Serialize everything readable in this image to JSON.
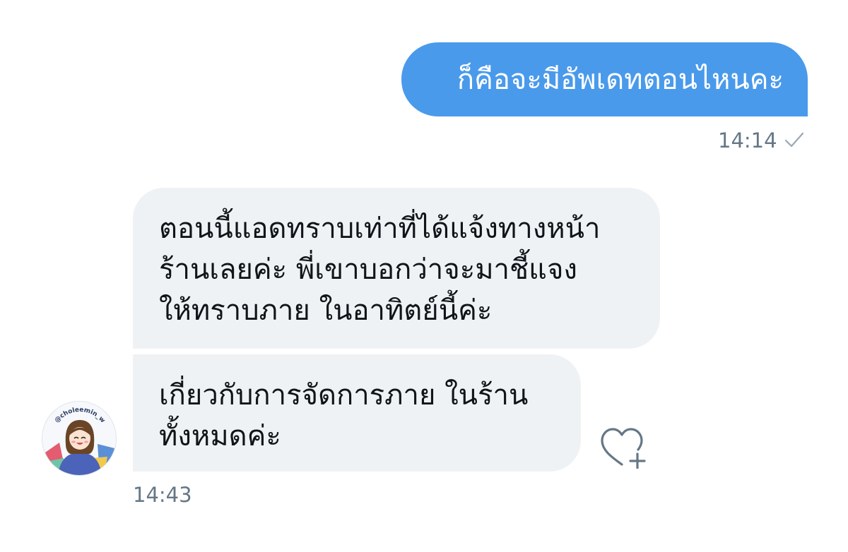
{
  "messages": {
    "outgoing": {
      "text": "ก็คือจะมีอัพเดทตอนไหนคะ",
      "time": "14:14",
      "status_icon": "checkmark-icon"
    },
    "incoming": {
      "bubble1_lines": [
        "ตอนนี้แอดทราบเท่าที่ได้แจ้งทางหน้า",
        "ร้านเลยค่ะ พี่เขาบอกว่าจะมาชี้แจง",
        "ให้ทราบภาย ในอาทิตย์นี้ค่ะ"
      ],
      "bubble2_lines": [
        "เกี่ยวกับการจัดการภาย ในร้าน",
        "ทั้งหมดค่ะ"
      ],
      "time": "14:43"
    }
  },
  "avatar": {
    "handle_text": "@choleemin_w",
    "icon": "user-avatar"
  },
  "reaction": {
    "icon": "heart-add-icon"
  },
  "colors": {
    "outgoing_bubble": "#4a9aeb",
    "incoming_bubble": "#eff2f4",
    "timestamp": "#657786",
    "icon_stroke": "#657786"
  }
}
